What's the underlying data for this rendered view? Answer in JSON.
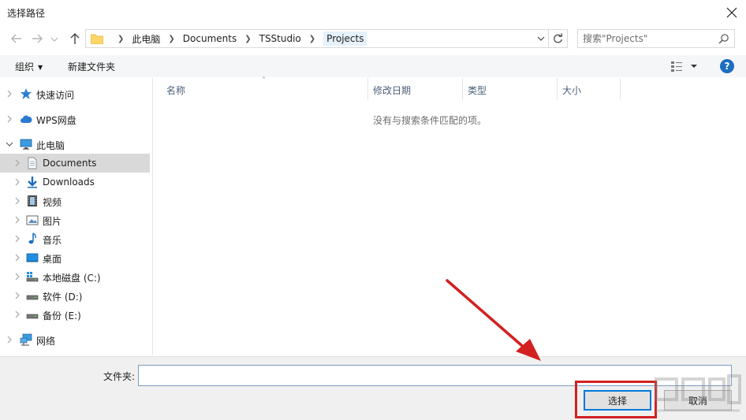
{
  "window": {
    "title": "选择路径"
  },
  "address": {
    "crumbs": [
      "此电脑",
      "Documents",
      "TSStudio",
      "Projects"
    ]
  },
  "search": {
    "placeholder": "搜索\"Projects\""
  },
  "toolbar": {
    "organize_label": "组织",
    "new_folder_label": "新建文件夹",
    "help_label": "?"
  },
  "sidebar": {
    "items": [
      {
        "label": "快速访问",
        "icon": "star-icon"
      },
      {
        "label": "WPS网盘",
        "icon": "cloud-icon"
      },
      {
        "label": "此电脑",
        "icon": "computer-icon"
      },
      {
        "label": "Documents",
        "icon": "document-icon"
      },
      {
        "label": "Downloads",
        "icon": "download-icon"
      },
      {
        "label": "视频",
        "icon": "video-icon"
      },
      {
        "label": "图片",
        "icon": "picture-icon"
      },
      {
        "label": "音乐",
        "icon": "music-icon"
      },
      {
        "label": "桌面",
        "icon": "desktop-icon"
      },
      {
        "label": "本地磁盘 (C:)",
        "icon": "system-drive-icon"
      },
      {
        "label": "软件 (D:)",
        "icon": "drive-icon"
      },
      {
        "label": "备份 (E:)",
        "icon": "drive-icon"
      },
      {
        "label": "网络",
        "icon": "network-icon"
      }
    ]
  },
  "columns": [
    "名称",
    "修改日期",
    "类型",
    "大小"
  ],
  "empty_message": "没有与搜索条件匹配的项。",
  "footer": {
    "filename_label": "文件夹:",
    "filename_value": "",
    "ok_label": "选择",
    "cancel_label": "取消"
  },
  "colors": {
    "accent": "#0078d7",
    "annotation": "#d32020",
    "selection": "#d9d9d9"
  }
}
